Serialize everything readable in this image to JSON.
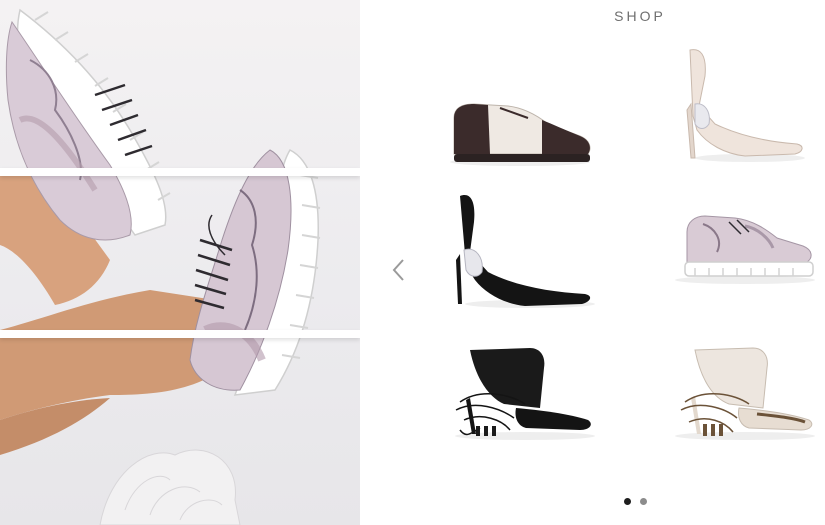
{
  "shop": {
    "title": "SHOP"
  },
  "carousel": {
    "prev_icon": "chevron-left-icon",
    "active_page": 1,
    "page_count": 2
  },
  "products": [
    {
      "type": "two-tone-derby",
      "colors": [
        "#3b2b2b",
        "#efe9e3"
      ]
    },
    {
      "type": "sculpted-heel-pump",
      "colors": [
        "#efe4dc"
      ]
    },
    {
      "type": "sculpted-heel-pump",
      "colors": [
        "#141414"
      ]
    },
    {
      "type": "printed-platform-derby",
      "colors": [
        "#d9cbd5",
        "#ffffff"
      ]
    },
    {
      "type": "lace-up-mule",
      "colors": [
        "#141414"
      ]
    },
    {
      "type": "lace-up-mule",
      "colors": [
        "#ede6df",
        "#6b5238"
      ]
    }
  ]
}
